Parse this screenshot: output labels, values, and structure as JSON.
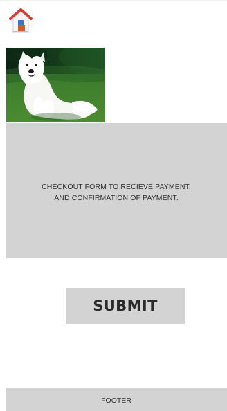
{
  "header": {
    "home_icon": "home-icon"
  },
  "hero": {
    "image": "white-dog-photo"
  },
  "content": {
    "line_1": "CHECKOUT FORM TO RECIEVE PAYMENT.",
    "line_2": "AND CONFIRMATION OF PAYMENT."
  },
  "form": {
    "submit_label": "SUBMIT"
  },
  "footer": {
    "label": "FOOTER"
  },
  "colors": {
    "panel_background": "#d3d3d3",
    "page_background": "#ffffff",
    "text": "#2f2f2f",
    "house_roof": "#d93b2f",
    "house_body": "#f4f6fa",
    "house_door": "#d95a1a",
    "house_window": "#3a74c8"
  }
}
